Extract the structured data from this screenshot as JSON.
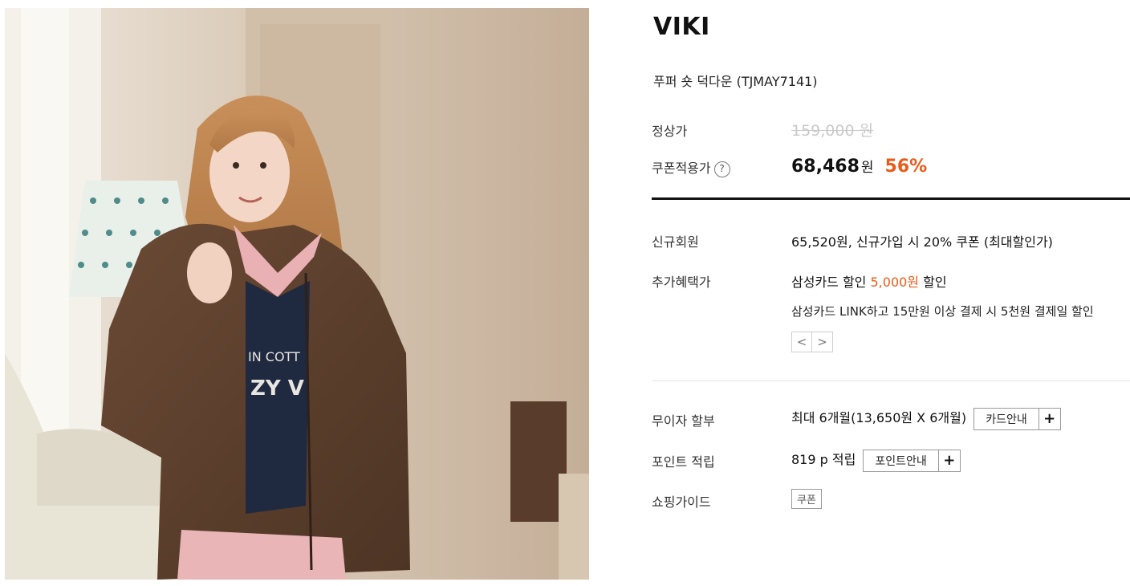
{
  "product": {
    "brand": "VIKI",
    "name": "푸퍼 숏 덕다운 (TJMAY7141)",
    "image_alt": "brown cropped puffer jacket worn by model"
  },
  "pricing": {
    "regular_label": "정상가",
    "regular_price": "159,000 원",
    "coupon_label": "쿠폰적용가",
    "help_icon_glyph": "?",
    "coupon_price": "68,468",
    "currency": "원",
    "discount": "56%"
  },
  "benefits": {
    "new_member_label": "신규회원",
    "new_member_text": "65,520원, 신규가입 시 20% 쿠폰 (최대할인가)",
    "extra_label": "추가혜택가",
    "extra_prefix": "삼성카드 할인",
    "extra_amount": "5,000원",
    "extra_suffix": "할인",
    "extra_detail": "삼성카드 LINK하고 15만원 이상 결제 시 5천원 결제일 할인",
    "prev_glyph": "<",
    "next_glyph": ">"
  },
  "services": {
    "installment_label": "무이자 할부",
    "installment_text": "최대 6개월(13,650원 X 6개월)",
    "card_guide_label": "카드안내",
    "points_label": "포인트 적립",
    "points_text": "819 p 적립",
    "points_guide_label": "포인트안내",
    "plus_glyph": "+",
    "shopping_guide_label": "쇼핑가이드",
    "coupon_tag": "쿠폰"
  },
  "colors": {
    "accent": "#ea5b1a",
    "strike": "#c9c9c9"
  },
  "icons": [
    "question-circle-icon",
    "chevron-left-icon",
    "chevron-right-icon",
    "plus-icon"
  ]
}
